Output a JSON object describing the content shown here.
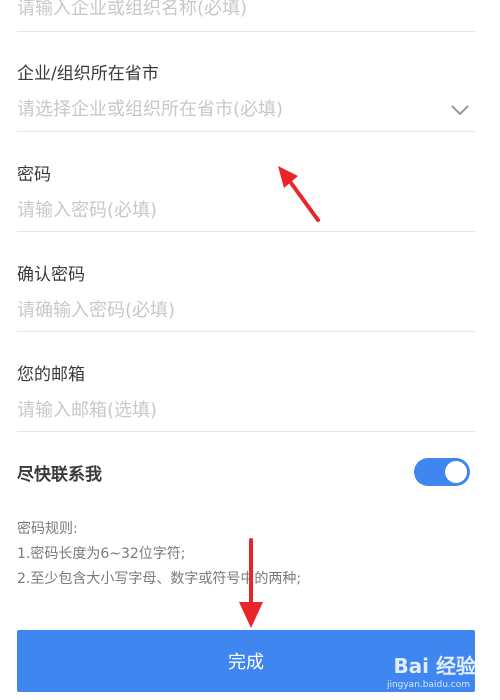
{
  "form": {
    "org_name_placeholder": "请输入企业或组织名称(必填)",
    "province_label": "企业/组织所在省市",
    "province_placeholder": "请选择企业或组织所在省市(必填)",
    "password_label": "密码",
    "password_placeholder": "请输入密码(必填)",
    "confirm_label": "确认密码",
    "confirm_placeholder": "请确输入密码(必填)",
    "email_label": "您的邮箱",
    "email_placeholder": "请输入邮箱(选填)"
  },
  "contact": {
    "label": "尽快联系我",
    "enabled": true
  },
  "rules": {
    "title": "密码规则:",
    "line1": "1.密码长度为6~32位字符;",
    "line2": "2.至少包含大小写字母、数字或符号中的两种;"
  },
  "submit_label": "完成",
  "watermark": {
    "text": "Bai 经验",
    "url": "jingyan.baidu.com"
  },
  "colors": {
    "accent": "#3f86f0",
    "annotation": "#e8262a"
  }
}
